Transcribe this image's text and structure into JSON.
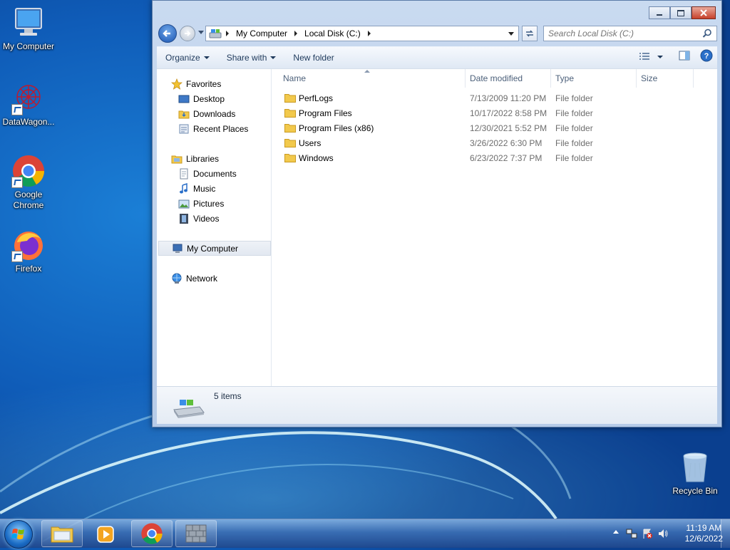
{
  "desktop": {
    "icons": [
      {
        "label": "My Computer",
        "icon": "my-computer-icon"
      },
      {
        "label": "DataWagon...",
        "icon": "datawagon-icon"
      },
      {
        "label": "Google Chrome",
        "icon": "chrome-icon"
      },
      {
        "label": "Firefox",
        "icon": "firefox-icon"
      },
      {
        "label": "Recycle Bin",
        "icon": "recycle-bin-icon"
      }
    ]
  },
  "explorer": {
    "breadcrumb": [
      "My Computer",
      "Local Disk (C:)"
    ],
    "search_placeholder": "Search Local Disk (C:)",
    "toolbar": {
      "organize": "Organize",
      "share_with": "Share with",
      "new_folder": "New folder"
    },
    "nav": {
      "favorites": "Favorites",
      "favorites_items": [
        "Desktop",
        "Downloads",
        "Recent Places"
      ],
      "libraries": "Libraries",
      "libraries_items": [
        "Documents",
        "Music",
        "Pictures",
        "Videos"
      ],
      "my_computer": "My Computer",
      "network": "Network"
    },
    "columns": {
      "name": "Name",
      "date_modified": "Date modified",
      "type": "Type",
      "size": "Size"
    },
    "files": [
      {
        "name": "PerfLogs",
        "date": "7/13/2009 11:20 PM",
        "type": "File folder"
      },
      {
        "name": "Program Files",
        "date": "10/17/2022 8:58 PM",
        "type": "File folder"
      },
      {
        "name": "Program Files (x86)",
        "date": "12/30/2021 5:52 PM",
        "type": "File folder"
      },
      {
        "name": "Users",
        "date": "3/26/2022 6:30 PM",
        "type": "File folder"
      },
      {
        "name": "Windows",
        "date": "6/23/2022 7:37 PM",
        "type": "File folder"
      }
    ],
    "status": "5 items"
  },
  "taskbar": {
    "clock_time": "11:19 AM",
    "clock_date": "12/6/2022"
  },
  "colors": {
    "folder": "#f2c94c",
    "accent": "#1e5fb4"
  }
}
